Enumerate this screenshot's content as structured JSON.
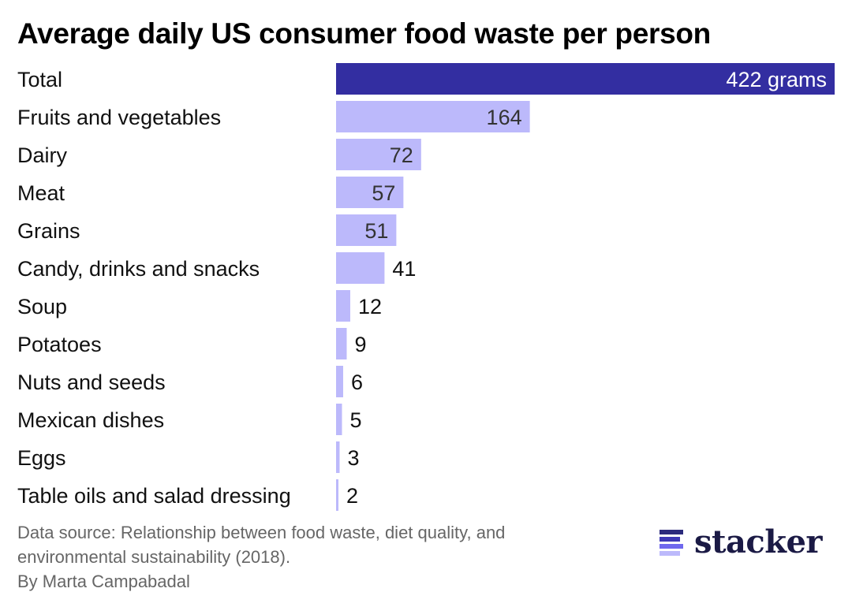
{
  "chart_data": {
    "type": "bar",
    "orientation": "horizontal",
    "title": "Average daily US consumer food waste per person",
    "xlabel": "",
    "ylabel": "",
    "unit": "grams",
    "categories": [
      "Total",
      "Fruits and vegetables",
      "Dairy",
      "Meat",
      "Grains",
      "Candy, drinks and snacks",
      "Soup",
      "Potatoes",
      "Nuts and seeds",
      "Mexican dishes",
      "Eggs",
      "Table oils and salad dressing"
    ],
    "values": [
      422,
      164,
      72,
      57,
      51,
      41,
      12,
      9,
      6,
      5,
      3,
      2
    ],
    "value_labels": [
      "422 grams",
      "164",
      "72",
      "57",
      "51",
      "41",
      "12",
      "9",
      "6",
      "5",
      "3",
      "2"
    ],
    "xlim": [
      0,
      422
    ],
    "grid": false,
    "legend": "none",
    "colors": {
      "total": "#332ea1",
      "category": "#bcb9fb",
      "label_on_dark": "#ffffff",
      "label_on_light": "#333333",
      "label_outside": "#111111"
    }
  },
  "footer": {
    "source_line1": "Data source: Relationship between food waste, diet quality, and",
    "source_line2": "environmental sustainability (2018).",
    "byline": "By Marta Campabadal"
  },
  "logo": {
    "text": "stacker",
    "mark_colors": [
      "#2b2a7c",
      "#3d38b5",
      "#6f68ee",
      "#bcb9fb"
    ]
  }
}
